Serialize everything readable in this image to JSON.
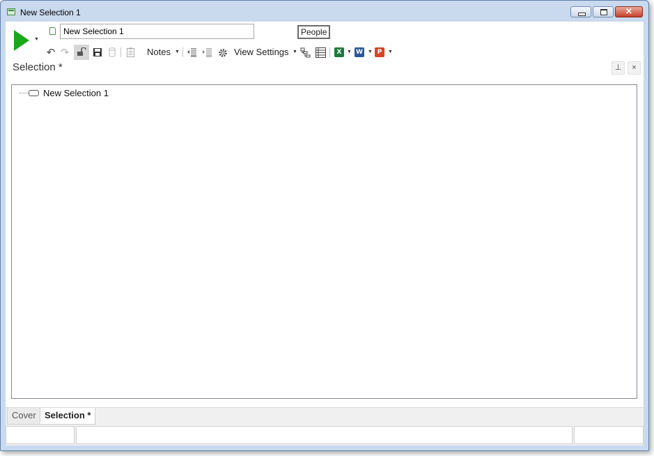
{
  "window": {
    "title": "New Selection 1",
    "icons": [
      "window-app-icon",
      "minimize-icon",
      "maximize-icon",
      "close-icon"
    ],
    "close_glyph": "×"
  },
  "header": {
    "run_icon": "play-icon",
    "name_input_value": "New Selection 1",
    "people_label": "People"
  },
  "toolbar": {
    "undo_glyph": "↶",
    "redo_glyph": "↷",
    "save_glyph": "💾",
    "notes_label": "Notes",
    "view_settings_label": "View Settings",
    "dropdown_glyph": "▼",
    "export_excel_glyph": "X",
    "export_word_glyph": "W",
    "export_powerpoint_glyph": "P",
    "colors": {
      "excel": "#1f7a3f",
      "word": "#2b579a",
      "powerpoint": "#d24726",
      "run": "#1aa81a"
    }
  },
  "panel": {
    "title": "Selection *",
    "pin_glyph": "⊥",
    "close_glyph": "×"
  },
  "tree": {
    "nodes": [
      {
        "label": "New Selection 1"
      }
    ]
  },
  "tabs": [
    {
      "label": "Cover",
      "active": false
    },
    {
      "label": "Selection *",
      "active": true
    }
  ]
}
